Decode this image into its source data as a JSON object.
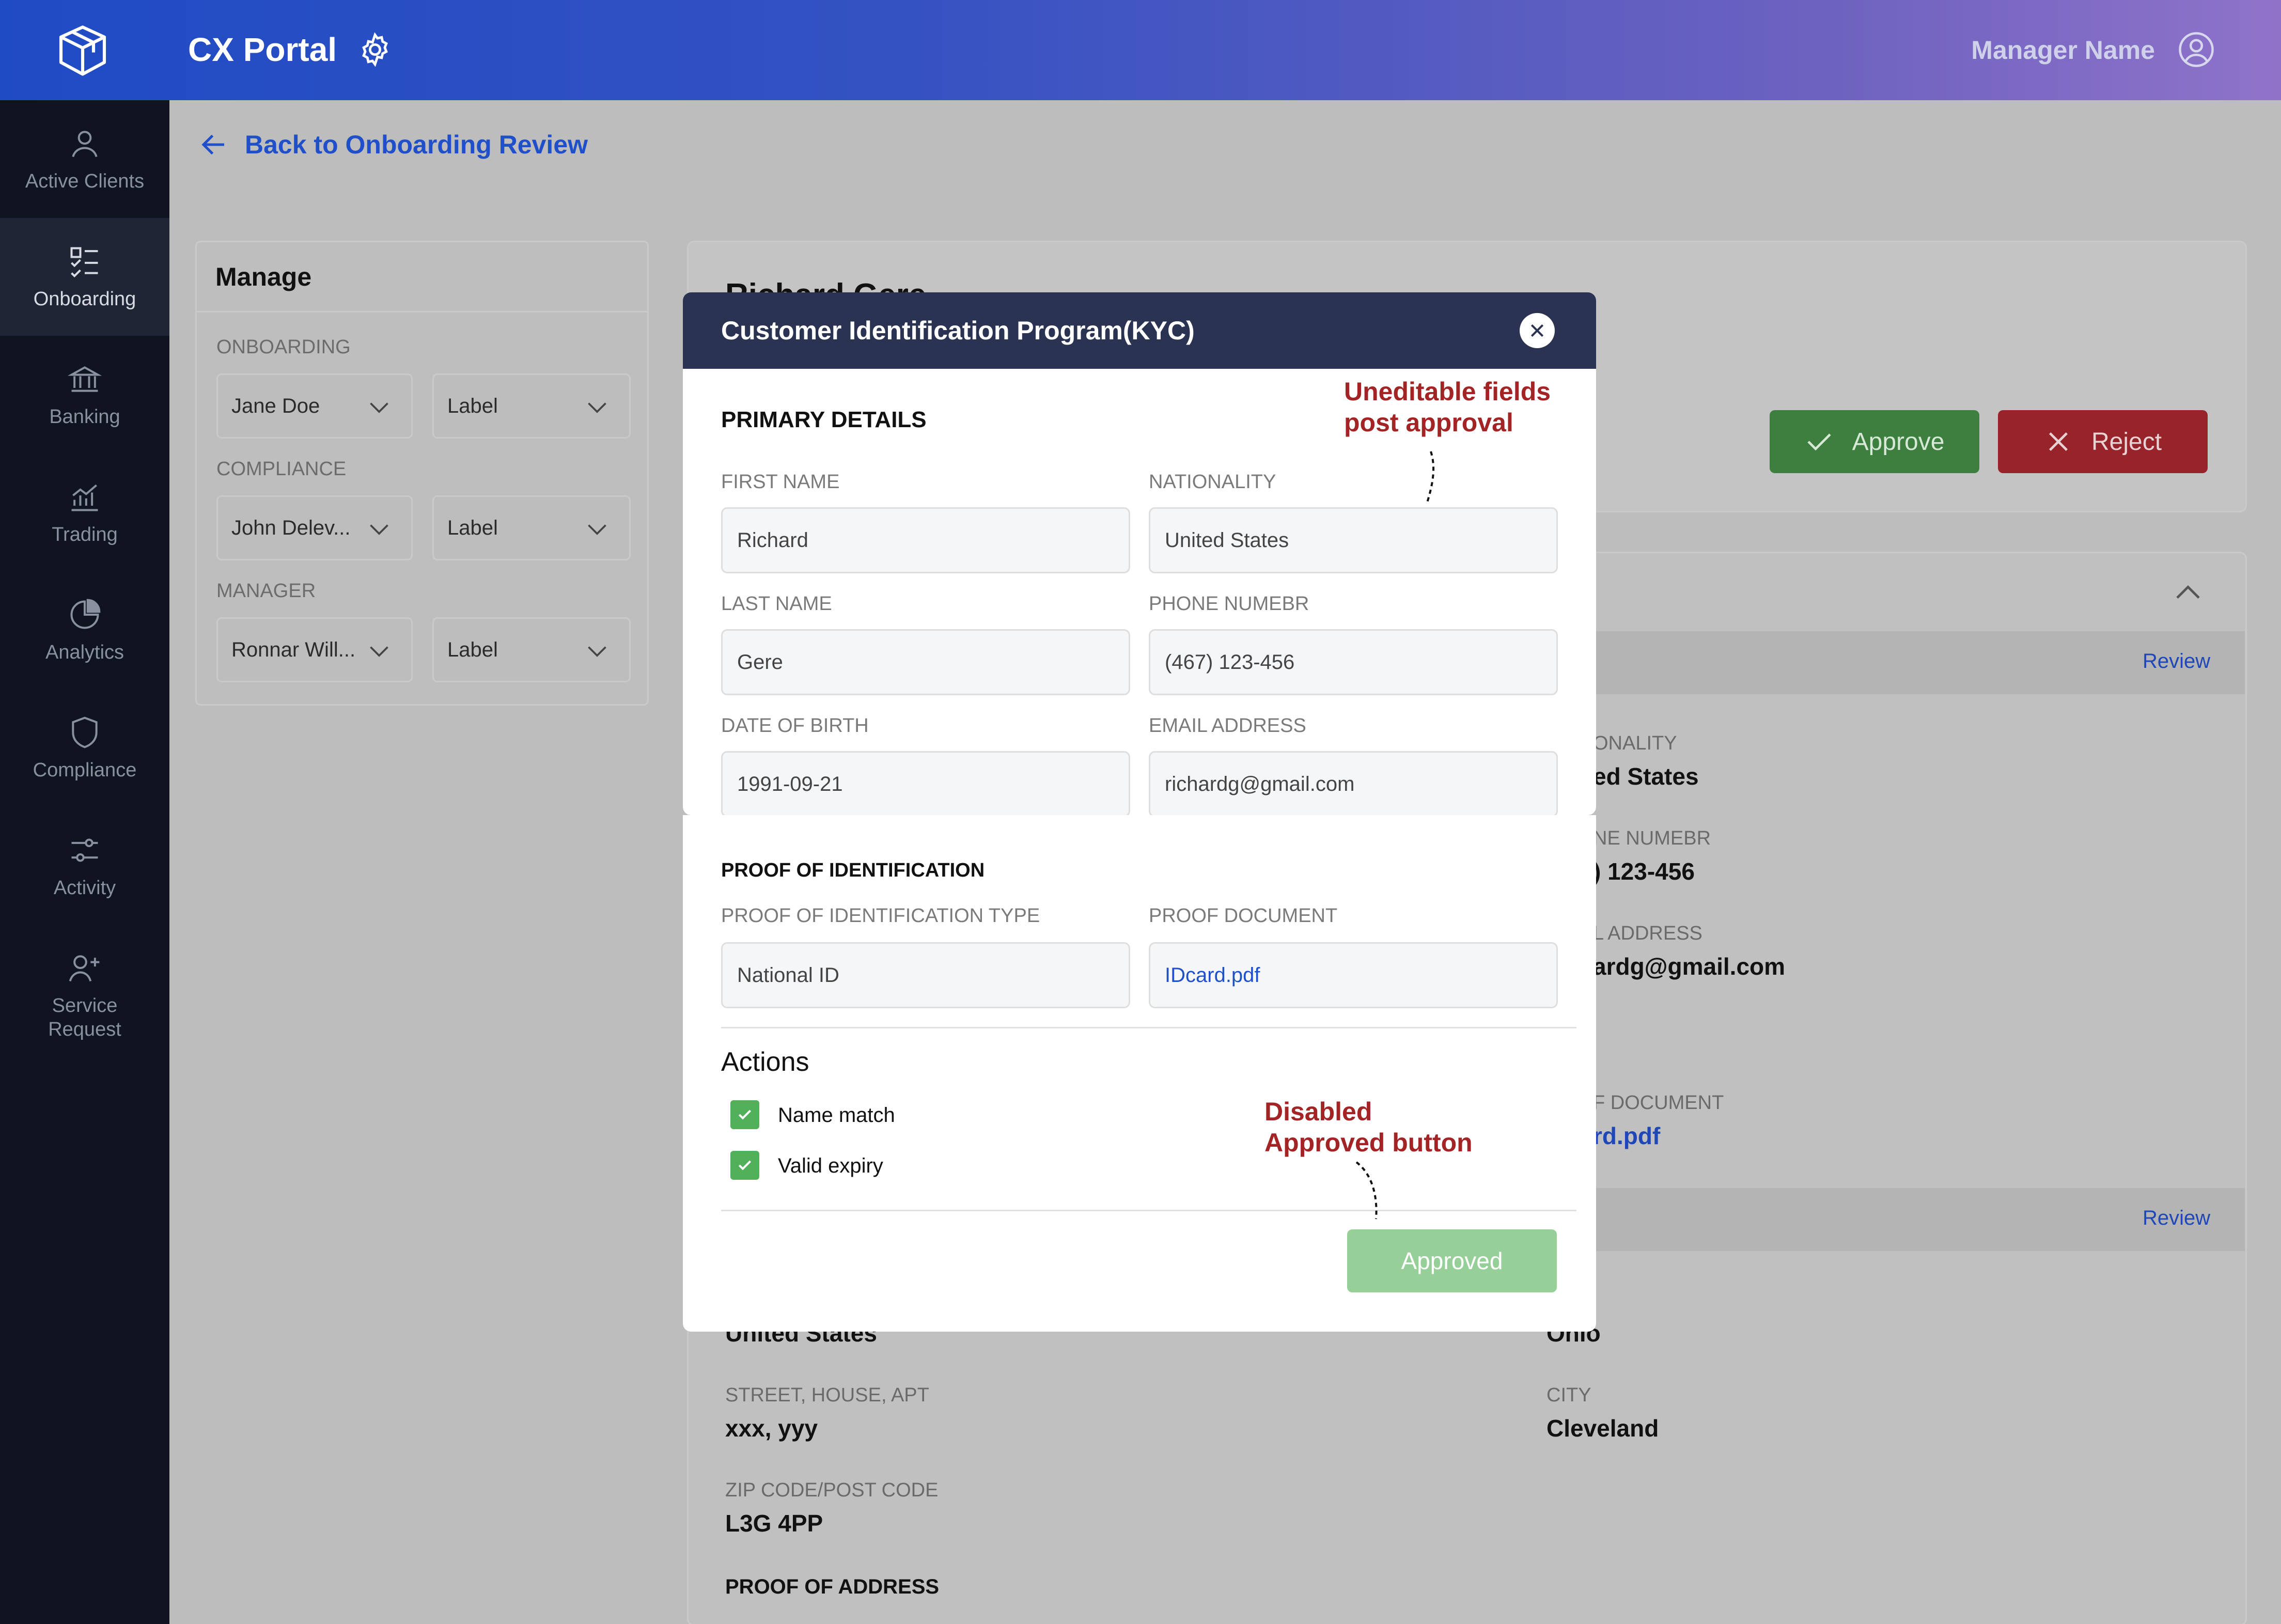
{
  "header": {
    "app_title": "CX Portal",
    "user_name": "Manager Name"
  },
  "sidebar": {
    "items": [
      {
        "label": "Active Clients",
        "icon": "user-icon"
      },
      {
        "label": "Onboarding",
        "icon": "checklist-icon",
        "active": true
      },
      {
        "label": "Banking",
        "icon": "bank-icon"
      },
      {
        "label": "Trading",
        "icon": "chart-icon"
      },
      {
        "label": "Analytics",
        "icon": "pie-icon"
      },
      {
        "label": "Compliance",
        "icon": "shield-icon"
      },
      {
        "label": "Activity",
        "icon": "sliders-icon"
      },
      {
        "label": "Service\nRequest",
        "icon": "add-user-icon"
      }
    ]
  },
  "back_link": "Back to Onboarding Review",
  "manage": {
    "title": "Manage",
    "groups": [
      {
        "label": "ONBOARDING",
        "value": "Jane Doe",
        "secondary": "Label"
      },
      {
        "label": "COMPLIANCE",
        "value": "John Delev...",
        "secondary": "Label"
      },
      {
        "label": "MANAGER",
        "value": "Ronnar Will...",
        "secondary": "Label"
      }
    ]
  },
  "background": {
    "client_name": "Richard Gere",
    "approve_label": "Approve",
    "reject_label": "Reject",
    "review_label": "Review",
    "fields_right": [
      {
        "label": "ONALITY",
        "value": "ed States"
      },
      {
        "label": "NE NUMEBR",
        "value": ") 123-456"
      },
      {
        "label": "L ADDRESS",
        "value": "ardg@gmail.com"
      },
      {
        "label": "F DOCUMENT",
        "value": "rd.pdf"
      }
    ],
    "address": {
      "country_value": "United States",
      "state_label": "E",
      "state_value": "Ohio",
      "street_label": "STREET, HOUSE, APT",
      "street_value": "xxx, yyy",
      "city_label": "CITY",
      "city_value": "Cleveland",
      "zip_label": "ZIP CODE/POST CODE",
      "zip_value": "L3G 4PP",
      "proof_title": "PROOF OF ADDRESS"
    }
  },
  "modal": {
    "title": "Customer Identification Program(KYC)",
    "primary_title": "PRIMARY DETAILS",
    "fields": {
      "first_name": {
        "label": "FIRST NAME",
        "value": "Richard"
      },
      "nationality": {
        "label": "NATIONALITY",
        "value": "United States"
      },
      "last_name": {
        "label": "LAST NAME",
        "value": "Gere"
      },
      "phone": {
        "label": "PHONE NUMEBR",
        "value": "(467) 123-456"
      },
      "dob": {
        "label": "DATE OF BIRTH",
        "value": "1991-09-21"
      },
      "email": {
        "label": "EMAIL ADDRESS",
        "value": "richardg@gmail.com"
      }
    },
    "proof_title": "PROOF OF IDENTIFICATION",
    "proof_type": {
      "label": "PROOF OF IDENTIFICATION TYPE",
      "value": "National ID"
    },
    "proof_doc": {
      "label": "PROOF DOCUMENT",
      "value": "IDcard.pdf"
    },
    "actions_title": "Actions",
    "checks": [
      {
        "label": "Name match",
        "checked": true
      },
      {
        "label": "Valid expiry",
        "checked": true
      }
    ],
    "approved_label": "Approved"
  },
  "notes": {
    "uneditable": "Uneditable fields\npost approval",
    "disabled": "Disabled\nApproved button"
  },
  "colors": {
    "header_start": "#1f4bc4",
    "header_end": "#8f73c9",
    "sidebar": "#0f1420",
    "modal_header": "#2a3452",
    "approve_green": "#3c7f3f",
    "reject_red": "#96242a",
    "approved_disabled": "#97cf98",
    "note_red": "#a32424",
    "link_blue": "#1f4fc9"
  }
}
